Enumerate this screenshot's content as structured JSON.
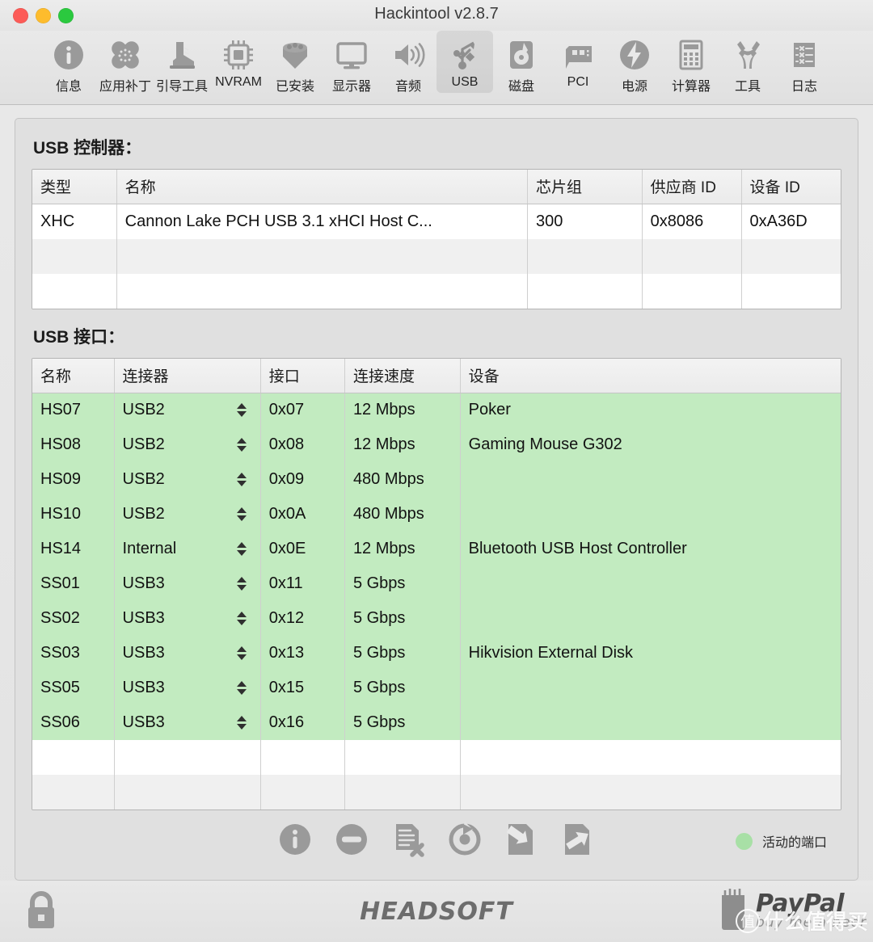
{
  "window": {
    "title": "Hackintool v2.8.7",
    "traffic_lights": [
      "close",
      "minimize",
      "zoom"
    ]
  },
  "toolbar": {
    "items": [
      {
        "label": "信息",
        "icon": "info-icon",
        "selected": false
      },
      {
        "label": "应用补丁",
        "icon": "bandage-icon",
        "selected": false
      },
      {
        "label": "引导工具",
        "icon": "boot-icon",
        "selected": false
      },
      {
        "label": "NVRAM",
        "icon": "chip-icon",
        "selected": false
      },
      {
        "label": "已安装",
        "icon": "package-icon",
        "selected": false
      },
      {
        "label": "显示器",
        "icon": "monitor-icon",
        "selected": false
      },
      {
        "label": "音频",
        "icon": "speaker-icon",
        "selected": false
      },
      {
        "label": "USB",
        "icon": "usb-icon",
        "selected": true
      },
      {
        "label": "磁盘",
        "icon": "disk-icon",
        "selected": false
      },
      {
        "label": "PCI",
        "icon": "pci-card-icon",
        "selected": false
      },
      {
        "label": "电源",
        "icon": "power-bolt-icon",
        "selected": false
      },
      {
        "label": "计算器",
        "icon": "calculator-icon",
        "selected": false
      },
      {
        "label": "工具",
        "icon": "wrench-icon",
        "selected": false
      },
      {
        "label": "日志",
        "icon": "log-list-icon",
        "selected": false
      }
    ]
  },
  "controller_section": {
    "title": "USB 控制器：",
    "columns": [
      "类型",
      "名称",
      "芯片组",
      "供应商 ID",
      "设备 ID"
    ],
    "rows": [
      {
        "type": "XHC",
        "name": "Cannon Lake PCH USB 3.1 xHCI Host C...",
        "chipset": "300",
        "vendor_id": "0x8086",
        "device_id": "0xA36D"
      }
    ],
    "empty_rows": 2
  },
  "interface_section": {
    "title": "USB 接口：",
    "columns": [
      "名称",
      "连接器",
      "接口",
      "连接速度",
      "设备"
    ],
    "rows": [
      {
        "name": "HS07",
        "connector": "USB2",
        "port": "0x07",
        "speed": "12 Mbps",
        "device": "Poker",
        "active": true
      },
      {
        "name": "HS08",
        "connector": "USB2",
        "port": "0x08",
        "speed": "12 Mbps",
        "device": "Gaming Mouse G302",
        "active": true
      },
      {
        "name": "HS09",
        "connector": "USB2",
        "port": "0x09",
        "speed": "480 Mbps",
        "device": "",
        "active": true
      },
      {
        "name": "HS10",
        "connector": "USB2",
        "port": "0x0A",
        "speed": "480 Mbps",
        "device": "",
        "active": true
      },
      {
        "name": "HS14",
        "connector": "Internal",
        "port": "0x0E",
        "speed": "12 Mbps",
        "device": "Bluetooth USB Host Controller",
        "active": true
      },
      {
        "name": "SS01",
        "connector": "USB3",
        "port": "0x11",
        "speed": "5 Gbps",
        "device": "",
        "active": true
      },
      {
        "name": "SS02",
        "connector": "USB3",
        "port": "0x12",
        "speed": "5 Gbps",
        "device": "",
        "active": true
      },
      {
        "name": "SS03",
        "connector": "USB3",
        "port": "0x13",
        "speed": "5 Gbps",
        "device": "Hikvision External Disk",
        "active": true
      },
      {
        "name": "SS05",
        "connector": "USB3",
        "port": "0x15",
        "speed": "5 Gbps",
        "device": "",
        "active": true
      },
      {
        "name": "SS06",
        "connector": "USB3",
        "port": "0x16",
        "speed": "5 Gbps",
        "device": "",
        "active": true
      }
    ],
    "empty_rows": 2
  },
  "action_bar": {
    "buttons": [
      {
        "name": "info-button",
        "icon": "info-circle-icon"
      },
      {
        "name": "remove-button",
        "icon": "minus-circle-icon"
      },
      {
        "name": "delete-file-button",
        "icon": "document-delete-icon"
      },
      {
        "name": "refresh-button",
        "icon": "refresh-icon"
      },
      {
        "name": "import-button",
        "icon": "import-document-icon"
      },
      {
        "name": "export-button",
        "icon": "export-document-icon"
      }
    ],
    "legend_label": "活动的端口",
    "legend_color": "#a8e0a6"
  },
  "status_bar": {
    "lock_icon": "padlock-icon",
    "brand": "HEADSOFT",
    "paypal_name": "PayPal",
    "paypal_sub": "buy me a beer",
    "watermark_mark": "值",
    "watermark_text": "什么值得买"
  },
  "colors": {
    "active_row": "#c2ebc0",
    "alt_row": "#f0f0f0",
    "window_bg": "#e4e4e4",
    "accent_green": "#2bc93f"
  }
}
